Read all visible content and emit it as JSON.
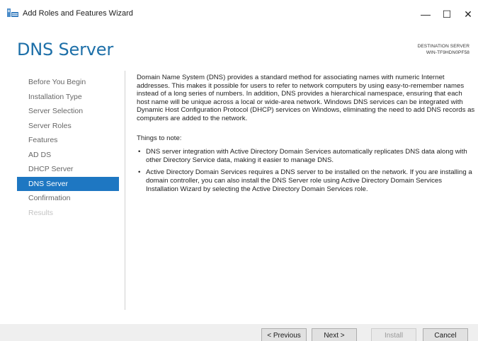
{
  "window": {
    "title": "Add Roles and Features Wizard",
    "minimize": "—",
    "maximize": "☐",
    "close": "✕",
    "icon": "server-manager-icon"
  },
  "page": {
    "title": "DNS Server"
  },
  "destination": {
    "label": "DESTINATION SERVER",
    "server": "WIN-TF9HDN0PF58"
  },
  "nav": {
    "items": [
      {
        "label": "Before You Begin"
      },
      {
        "label": "Installation Type"
      },
      {
        "label": "Server Selection"
      },
      {
        "label": "Server Roles"
      },
      {
        "label": "Features"
      },
      {
        "label": "AD DS"
      },
      {
        "label": "DHCP Server"
      },
      {
        "label": "DNS Server",
        "state": "active"
      },
      {
        "label": "Confirmation"
      },
      {
        "label": "Results",
        "state": "disabled"
      }
    ]
  },
  "content": {
    "intro": "Domain Name System (DNS) provides a standard method for associating names with numeric Internet addresses. This makes it possible for users to refer to network computers by using easy-to-remember names instead of a long series of numbers. In addition, DNS provides a hierarchical namespace, ensuring that each host name will be unique across a local or wide-area network. Windows DNS services can be integrated with Dynamic Host Configuration Protocol (DHCP) services on Windows, eliminating the need to add DNS records as computers are added to the network.",
    "notes_heading": "Things to note:",
    "notes": [
      "DNS server integration with Active Directory Domain Services automatically replicates DNS data along with other Directory Service data, making it easier to manage DNS.",
      "Active Directory Domain Services requires a DNS server to be installed on the network. If you are installing a domain controller, you can also install the DNS Server role using Active Directory Domain Services Installation Wizard by selecting the Active Directory Domain Services role."
    ],
    "bullet": "•"
  },
  "buttons": {
    "previous": "< Previous",
    "next": "Next >",
    "install": "Install",
    "cancel": "Cancel"
  },
  "colors": {
    "accent": "#1e77c2",
    "title": "#1d6fa8"
  }
}
